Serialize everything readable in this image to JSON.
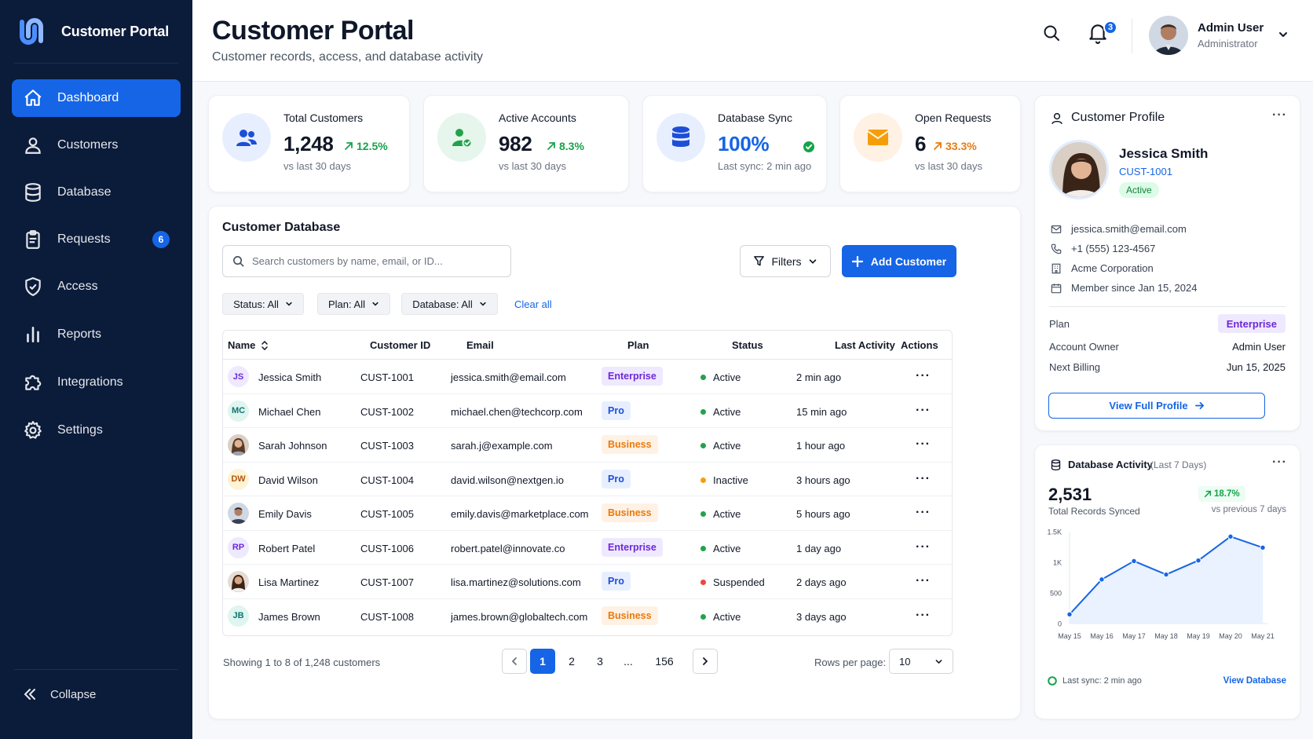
{
  "app": {
    "title": "Customer Portal"
  },
  "nav": {
    "items": [
      {
        "label": "Dashboard",
        "icon": "home-icon",
        "active": true
      },
      {
        "label": "Customers",
        "icon": "user-icon"
      },
      {
        "label": "Database",
        "icon": "database-icon"
      },
      {
        "label": "Requests",
        "icon": "clipboard-icon",
        "badge": "6"
      },
      {
        "label": "Access",
        "icon": "shield-check-icon"
      },
      {
        "label": "Reports",
        "icon": "bar-chart-icon"
      },
      {
        "label": "Integrations",
        "icon": "puzzle-icon"
      },
      {
        "label": "Settings",
        "icon": "gear-icon"
      }
    ],
    "collapse_label": "Collapse"
  },
  "header": {
    "title": "Customer Portal",
    "subtitle": "Customer records, access, and database activity",
    "notification_count": "3",
    "user_name": "Admin User",
    "user_role": "Administrator"
  },
  "stats": [
    {
      "label": "Total Customers",
      "value": "1,248",
      "delta": "12.5%",
      "foot": "vs last 30 days",
      "icon": "users-icon"
    },
    {
      "label": "Active Accounts",
      "value": "982",
      "delta": "8.3%",
      "foot": "vs last 30 days",
      "icon": "user-check-icon"
    },
    {
      "label": "Database Sync",
      "value": "100%",
      "foot": "Last sync: 2 min ago",
      "icon": "database-icon"
    },
    {
      "label": "Open Requests",
      "value": "6",
      "delta": "33.3%",
      "foot": "vs last 30 days",
      "icon": "mail-icon"
    }
  ],
  "database": {
    "title": "Customer Database",
    "search_placeholder": "Search customers by name, email, or ID...",
    "filters_label": "Filters",
    "add_label": "Add Customer",
    "chips": [
      "Status: All",
      "Plan: All",
      "Database: All"
    ],
    "clear_all": "Clear all",
    "columns": [
      "Name",
      "Customer ID",
      "Email",
      "Plan",
      "Status",
      "Last Activity",
      "Actions"
    ],
    "rows": [
      {
        "initials": "JS",
        "name": "Jessica Smith",
        "id": "CUST-1001",
        "email": "jessica.smith@email.com",
        "plan": "Enterprise",
        "status": "Active",
        "activity": "2 min ago"
      },
      {
        "initials": "MC",
        "name": "Michael Chen",
        "id": "CUST-1002",
        "email": "michael.chen@techcorp.com",
        "plan": "Pro",
        "status": "Active",
        "activity": "15 min ago"
      },
      {
        "initials": "",
        "name": "Sarah Johnson",
        "id": "CUST-1003",
        "email": "sarah.j@example.com",
        "plan": "Business",
        "status": "Active",
        "activity": "1 hour ago"
      },
      {
        "initials": "DW",
        "name": "David Wilson",
        "id": "CUST-1004",
        "email": "david.wilson@nextgen.io",
        "plan": "Pro",
        "status": "Inactive",
        "activity": "3 hours ago"
      },
      {
        "initials": "",
        "name": "Emily Davis",
        "id": "CUST-1005",
        "email": "emily.davis@marketplace.com",
        "plan": "Business",
        "status": "Active",
        "activity": "5 hours ago"
      },
      {
        "initials": "RP",
        "name": "Robert Patel",
        "id": "CUST-1006",
        "email": "robert.patel@innovate.co",
        "plan": "Enterprise",
        "status": "Active",
        "activity": "1 day ago"
      },
      {
        "initials": "",
        "name": "Lisa Martinez",
        "id": "CUST-1007",
        "email": "lisa.martinez@solutions.com",
        "plan": "Pro",
        "status": "Suspended",
        "activity": "2 days ago"
      },
      {
        "initials": "JB",
        "name": "James Brown",
        "id": "CUST-1008",
        "email": "james.brown@globaltech.com",
        "plan": "Business",
        "status": "Active",
        "activity": "3 days ago"
      }
    ],
    "showing": "Showing 1 to 8 of 1,248 customers",
    "pages": [
      "1",
      "2",
      "3",
      "...",
      "156"
    ],
    "rows_per_page_label": "Rows per page:",
    "rows_per_page": "10"
  },
  "profile": {
    "title": "Customer Profile",
    "name": "Jessica Smith",
    "id": "CUST-1001",
    "status": "Active",
    "email": "jessica.smith@email.com",
    "phone": "+1 (555) 123-4567",
    "company": "Acme Corporation",
    "member_since": "Member since Jan 15, 2024",
    "plan_label": "Plan",
    "plan": "Enterprise",
    "owner_label": "Account Owner",
    "owner": "Admin User",
    "billing_label": "Next Billing",
    "billing": "Jun 15, 2025",
    "view_label": "View Full Profile"
  },
  "activity": {
    "title": "Database Activity",
    "period": "(Last 7 Days)",
    "total": "2,531",
    "total_caption": "Total Records Synced",
    "delta": "18.7%",
    "vs": "vs previous 7 days",
    "sync": "Last sync: 2 min ago",
    "link": "View Database"
  },
  "colors": {
    "accent": "#1565e6",
    "sidebar": "#0b1b3a",
    "active": "#22a34a",
    "inactive": "#f59e0b",
    "suspended": "#ef4444"
  },
  "chart_data": {
    "type": "area",
    "x": [
      "May 15",
      "May 16",
      "May 17",
      "May 18",
      "May 19",
      "May 20",
      "May 21"
    ],
    "series": [
      {
        "values": [
          150,
          720,
          1020,
          800,
          1030,
          1420,
          1240
        ]
      }
    ],
    "yticks": [
      "0",
      "500",
      "1K",
      "1.5K"
    ],
    "ylim": [
      0,
      1500
    ],
    "grid": false
  }
}
